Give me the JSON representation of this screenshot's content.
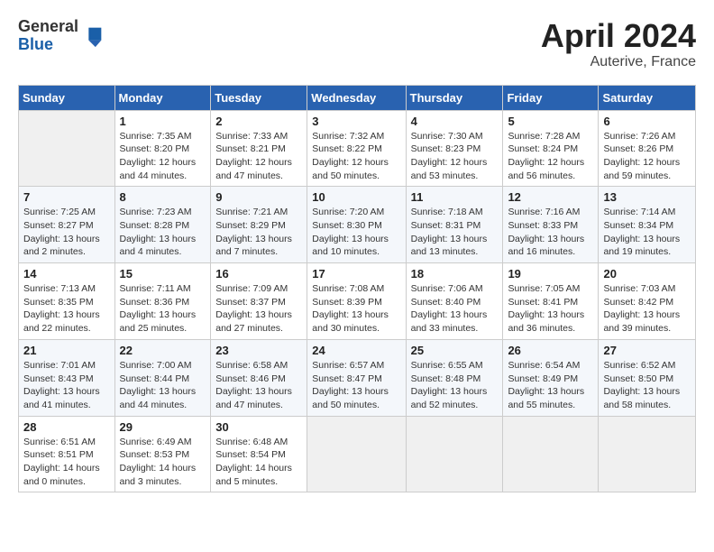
{
  "header": {
    "logo_general": "General",
    "logo_blue": "Blue",
    "title": "April 2024",
    "subtitle": "Auterive, France"
  },
  "days_of_week": [
    "Sunday",
    "Monday",
    "Tuesday",
    "Wednesday",
    "Thursday",
    "Friday",
    "Saturday"
  ],
  "weeks": [
    [
      {
        "day": "",
        "info": ""
      },
      {
        "day": "1",
        "info": "Sunrise: 7:35 AM\nSunset: 8:20 PM\nDaylight: 12 hours\nand 44 minutes."
      },
      {
        "day": "2",
        "info": "Sunrise: 7:33 AM\nSunset: 8:21 PM\nDaylight: 12 hours\nand 47 minutes."
      },
      {
        "day": "3",
        "info": "Sunrise: 7:32 AM\nSunset: 8:22 PM\nDaylight: 12 hours\nand 50 minutes."
      },
      {
        "day": "4",
        "info": "Sunrise: 7:30 AM\nSunset: 8:23 PM\nDaylight: 12 hours\nand 53 minutes."
      },
      {
        "day": "5",
        "info": "Sunrise: 7:28 AM\nSunset: 8:24 PM\nDaylight: 12 hours\nand 56 minutes."
      },
      {
        "day": "6",
        "info": "Sunrise: 7:26 AM\nSunset: 8:26 PM\nDaylight: 12 hours\nand 59 minutes."
      }
    ],
    [
      {
        "day": "7",
        "info": "Sunrise: 7:25 AM\nSunset: 8:27 PM\nDaylight: 13 hours\nand 2 minutes."
      },
      {
        "day": "8",
        "info": "Sunrise: 7:23 AM\nSunset: 8:28 PM\nDaylight: 13 hours\nand 4 minutes."
      },
      {
        "day": "9",
        "info": "Sunrise: 7:21 AM\nSunset: 8:29 PM\nDaylight: 13 hours\nand 7 minutes."
      },
      {
        "day": "10",
        "info": "Sunrise: 7:20 AM\nSunset: 8:30 PM\nDaylight: 13 hours\nand 10 minutes."
      },
      {
        "day": "11",
        "info": "Sunrise: 7:18 AM\nSunset: 8:31 PM\nDaylight: 13 hours\nand 13 minutes."
      },
      {
        "day": "12",
        "info": "Sunrise: 7:16 AM\nSunset: 8:33 PM\nDaylight: 13 hours\nand 16 minutes."
      },
      {
        "day": "13",
        "info": "Sunrise: 7:14 AM\nSunset: 8:34 PM\nDaylight: 13 hours\nand 19 minutes."
      }
    ],
    [
      {
        "day": "14",
        "info": "Sunrise: 7:13 AM\nSunset: 8:35 PM\nDaylight: 13 hours\nand 22 minutes."
      },
      {
        "day": "15",
        "info": "Sunrise: 7:11 AM\nSunset: 8:36 PM\nDaylight: 13 hours\nand 25 minutes."
      },
      {
        "day": "16",
        "info": "Sunrise: 7:09 AM\nSunset: 8:37 PM\nDaylight: 13 hours\nand 27 minutes."
      },
      {
        "day": "17",
        "info": "Sunrise: 7:08 AM\nSunset: 8:39 PM\nDaylight: 13 hours\nand 30 minutes."
      },
      {
        "day": "18",
        "info": "Sunrise: 7:06 AM\nSunset: 8:40 PM\nDaylight: 13 hours\nand 33 minutes."
      },
      {
        "day": "19",
        "info": "Sunrise: 7:05 AM\nSunset: 8:41 PM\nDaylight: 13 hours\nand 36 minutes."
      },
      {
        "day": "20",
        "info": "Sunrise: 7:03 AM\nSunset: 8:42 PM\nDaylight: 13 hours\nand 39 minutes."
      }
    ],
    [
      {
        "day": "21",
        "info": "Sunrise: 7:01 AM\nSunset: 8:43 PM\nDaylight: 13 hours\nand 41 minutes."
      },
      {
        "day": "22",
        "info": "Sunrise: 7:00 AM\nSunset: 8:44 PM\nDaylight: 13 hours\nand 44 minutes."
      },
      {
        "day": "23",
        "info": "Sunrise: 6:58 AM\nSunset: 8:46 PM\nDaylight: 13 hours\nand 47 minutes."
      },
      {
        "day": "24",
        "info": "Sunrise: 6:57 AM\nSunset: 8:47 PM\nDaylight: 13 hours\nand 50 minutes."
      },
      {
        "day": "25",
        "info": "Sunrise: 6:55 AM\nSunset: 8:48 PM\nDaylight: 13 hours\nand 52 minutes."
      },
      {
        "day": "26",
        "info": "Sunrise: 6:54 AM\nSunset: 8:49 PM\nDaylight: 13 hours\nand 55 minutes."
      },
      {
        "day": "27",
        "info": "Sunrise: 6:52 AM\nSunset: 8:50 PM\nDaylight: 13 hours\nand 58 minutes."
      }
    ],
    [
      {
        "day": "28",
        "info": "Sunrise: 6:51 AM\nSunset: 8:51 PM\nDaylight: 14 hours\nand 0 minutes."
      },
      {
        "day": "29",
        "info": "Sunrise: 6:49 AM\nSunset: 8:53 PM\nDaylight: 14 hours\nand 3 minutes."
      },
      {
        "day": "30",
        "info": "Sunrise: 6:48 AM\nSunset: 8:54 PM\nDaylight: 14 hours\nand 5 minutes."
      },
      {
        "day": "",
        "info": ""
      },
      {
        "day": "",
        "info": ""
      },
      {
        "day": "",
        "info": ""
      },
      {
        "day": "",
        "info": ""
      }
    ]
  ]
}
